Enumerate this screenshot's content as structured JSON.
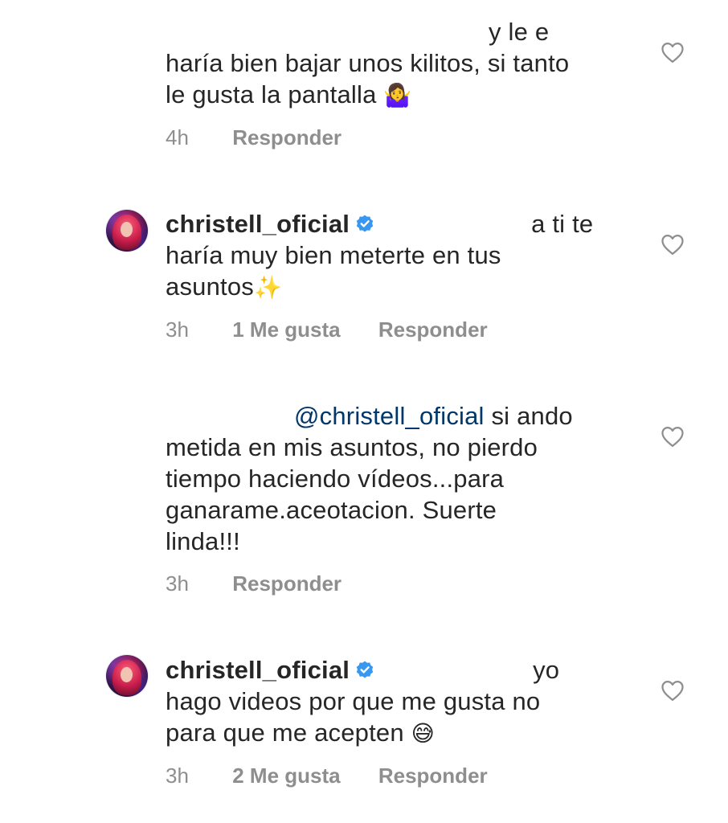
{
  "comments": [
    {
      "username": "",
      "text_lines": [
        "y le e",
        "haría bien bajar unos kilitos, si tanto",
        "le gusta la pantalla"
      ],
      "emoji": "🤷‍♀️",
      "time": "4h",
      "likes": "",
      "reply_label": "Responder",
      "verified": false
    },
    {
      "username": "christell_oficial",
      "text_lines": [
        "a ti te",
        "haría muy bien meterte en tus",
        "asuntos"
      ],
      "emoji": "✨",
      "time": "3h",
      "likes": "1 Me gusta",
      "reply_label": "Responder",
      "verified": true
    },
    {
      "username": "",
      "mention": "@christell_oficial",
      "text_lines": [
        "si ando",
        "metida en mis asuntos, no pierdo",
        "tiempo haciendo vídeos...para",
        "ganarame.aceotacion. Suerte",
        "linda!!!"
      ],
      "time": "3h",
      "likes": "",
      "reply_label": "Responder",
      "verified": false
    },
    {
      "username": "christell_oficial",
      "text_lines": [
        "yo",
        "hago videos por que me gusta no",
        "para que me acepten"
      ],
      "emoji": "😅",
      "time": "3h",
      "likes": "2 Me gusta",
      "reply_label": "Responder",
      "verified": true
    }
  ],
  "colors": {
    "text": "#262626",
    "meta": "#8e8e8e",
    "mention": "#00376b",
    "verified": "#3897f0"
  },
  "icons": {
    "like": "heart-outline-icon",
    "verified": "verified-badge-icon"
  }
}
